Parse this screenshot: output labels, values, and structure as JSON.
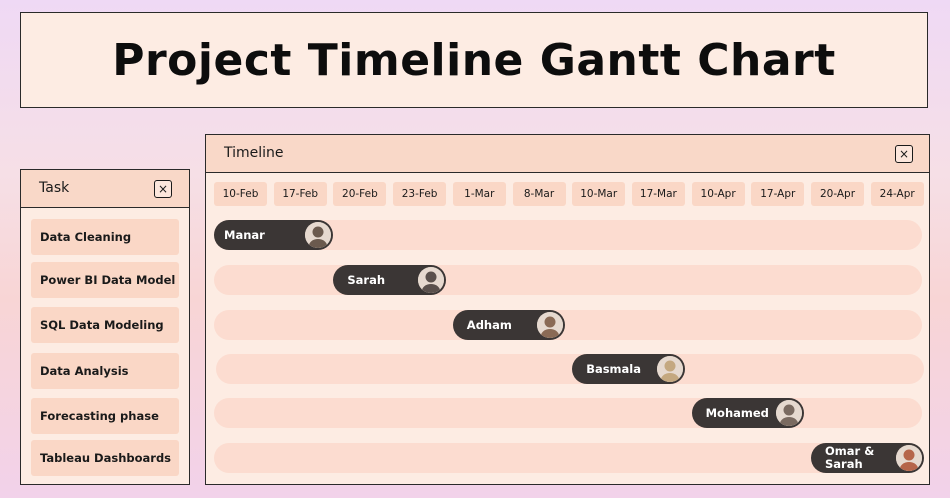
{
  "page": {
    "title": "Project Timeline Gantt Chart"
  },
  "task_panel": {
    "header": "Task",
    "close_icon": "×"
  },
  "timeline_panel": {
    "header": "Timeline",
    "close_icon": "×"
  },
  "chart_data": {
    "type": "gantt",
    "dates": [
      "10-Feb",
      "17-Feb",
      "20-Feb",
      "23-Feb",
      "1-Mar",
      "8-Mar",
      "10-Mar",
      "17-Mar",
      "10-Apr",
      "17-Apr",
      "20-Apr",
      "24-Apr"
    ],
    "tasks": [
      {
        "name": "Data Cleaning",
        "assignee": "Manar",
        "start": "10-Feb",
        "end": "17-Feb",
        "avatar_icon": "manar-avatar",
        "avatar_color": "#6b5a4e"
      },
      {
        "name": "Power BI Data Model",
        "assignee": "Sarah",
        "start": "20-Feb",
        "end": "23-Feb",
        "avatar_icon": "sarah-avatar",
        "avatar_color": "#5a504c"
      },
      {
        "name": "SQL Data Modeling",
        "assignee": "Adham",
        "start": "1-Mar",
        "end": "8-Mar",
        "avatar_icon": "adham-avatar",
        "avatar_color": "#8a6a55"
      },
      {
        "name": "Data Analysis",
        "assignee": "Basmala",
        "start": "10-Mar",
        "end": "17-Mar",
        "avatar_icon": "basmala-avatar",
        "avatar_color": "#c4a880"
      },
      {
        "name": "Forecasting phase",
        "assignee": "Mohamed",
        "start": "10-Apr",
        "end": "17-Apr",
        "avatar_icon": "mohamed-avatar",
        "avatar_color": "#7a6a60"
      },
      {
        "name": "Tableau Dashboards",
        "assignee": "Omar &\nSarah",
        "start": "20-Apr",
        "end": "24-Apr",
        "avatar_icon": "omar-sarah-avatar",
        "avatar_color": "#b5654a"
      }
    ]
  }
}
